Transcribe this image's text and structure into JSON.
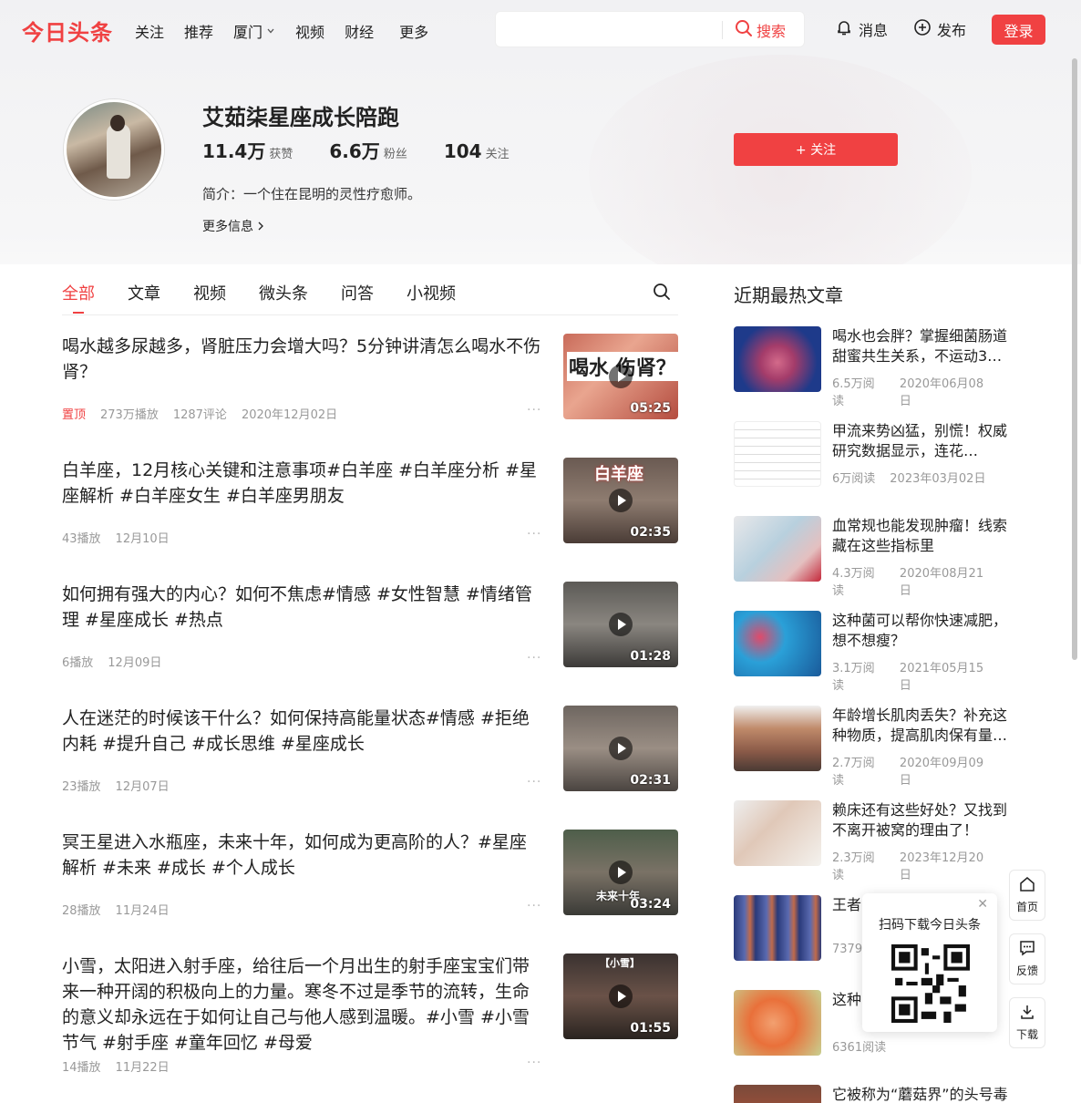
{
  "topnav": {
    "logo": "今日头条",
    "links": [
      "关注",
      "推荐",
      "厦门",
      "视频",
      "财经",
      "更多"
    ],
    "search_button": "搜索",
    "search_placeholder": "",
    "messages": "消息",
    "publish": "发布",
    "login": "登录"
  },
  "profile": {
    "name": "艾茹柒星座成长陪跑",
    "likes_num": "11.4万",
    "likes_label": "获赞",
    "fans_num": "6.6万",
    "fans_label": "粉丝",
    "following_num": "104",
    "following_label": "关注",
    "bio": "简介：一个住在昆明的灵性疗愈师。",
    "more_info": "更多信息",
    "follow_button": "+ 关注"
  },
  "tabs": [
    "全部",
    "文章",
    "视频",
    "微头条",
    "问答",
    "小视频"
  ],
  "feed": [
    {
      "title": "喝水越多尿越多，肾脏压力会增大吗？5分钟讲清怎么喝水不伤肾？",
      "pinned": "置顶",
      "plays": "273万播放",
      "comments": "1287评论",
      "date": "2020年12月02日",
      "duration": "05:25",
      "caption": "喝水 伤肾？"
    },
    {
      "title": "白羊座，12月核心关键和注意事项#白羊座 #白羊座分析 #星座解析 #白羊座女生 #白羊座男朋友",
      "plays": "43播放",
      "date": "12月10日",
      "duration": "02:35",
      "caption": "白羊座"
    },
    {
      "title": "如何拥有强大的内心？如何不焦虑#情感 #女性智慧 #情绪管理 #星座成长 #热点",
      "plays": "6播放",
      "date": "12月09日",
      "duration": "01:28"
    },
    {
      "title": "人在迷茫的时候该干什么？如何保持高能量状态#情感 #拒绝内耗 #提升自己 #成长思维 #星座成长",
      "plays": "23播放",
      "date": "12月07日",
      "duration": "02:31"
    },
    {
      "title": "冥王星进入水瓶座，未来十年，如何成为更高阶的人？#星座解析 #未来 #成长 #个人成长",
      "plays": "28播放",
      "date": "11月24日",
      "duration": "03:24",
      "caption": "未来十年"
    },
    {
      "title": "小雪，太阳进入射手座，给往后一个月出生的射手座宝宝们带来一种开阔的积极向上的力量。寒冬不过是季节的流转，生命的意义却永远在于如何让自己与他人感到温暖。#小雪 #小雪节气 #射手座 #童年回忆 #母爱",
      "plays": "14播放",
      "date": "11月22日",
      "duration": "01:55",
      "caption": "【小雪】"
    }
  ],
  "sidebar": {
    "title": "近期最热文章",
    "items": [
      {
        "title": "喝水也会胖？掌握细菌肠道甜蜜共生关系，不运动3…",
        "reads": "6.5万阅读",
        "date": "2020年06月08日",
        "color": "#2a4fa8"
      },
      {
        "title": "甲流来势凶猛，别慌！权威研究数据显示，连花…",
        "reads": "6万阅读",
        "date": "2023年03月02日",
        "color": "#f2f2f2"
      },
      {
        "title": "血常规也能发现肿瘤！线索藏在这些指标里",
        "reads": "4.3万阅读",
        "date": "2020年08月21日",
        "color": "#a9c6d8"
      },
      {
        "title": "这种菌可以帮你快速减肥，想不想瘦？",
        "reads": "3.1万阅读",
        "date": "2021年05月15日",
        "color": "#2a8fc8"
      },
      {
        "title": "年龄增长肌肉丢失？补充这种物质，提高肌肉保有量…",
        "reads": "2.7万阅读",
        "date": "2020年09月09日",
        "color": "#8a5a48"
      },
      {
        "title": "赖床还有这些好处？又找到不离开被窝的理由了！",
        "reads": "2.3万阅读",
        "date": "2023年12月20日",
        "color": "#d8d4cc"
      },
      {
        "title": "王者",
        "reads": "7379",
        "date": "",
        "color": "#3a4f8a"
      },
      {
        "title": "这种",
        "reads": "6361阅读",
        "date": "",
        "color": "#e9803a"
      },
      {
        "title": "它被称为“蘑菇界”的头号毒",
        "reads": "",
        "date": "",
        "color": "#7a4a3a"
      }
    ]
  },
  "floating": {
    "qr_title": "扫码下载今日头条",
    "home": "首页",
    "feedback": "反馈",
    "download": "下载"
  },
  "colors": {
    "accent": "#f04142"
  }
}
